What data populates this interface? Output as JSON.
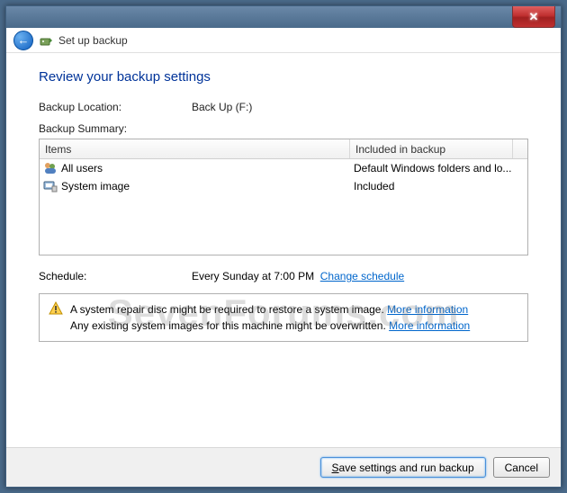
{
  "window": {
    "close": "✕"
  },
  "header": {
    "title": "Set up backup"
  },
  "page": {
    "title": "Review your backup settings",
    "backup_location_label": "Backup Location:",
    "backup_location_value": "Back Up (F:)",
    "summary_label": "Backup Summary:"
  },
  "table": {
    "col1": "Items",
    "col2": "Included in backup",
    "rows": [
      {
        "icon": "users",
        "item": "All users",
        "included": "Default Windows folders and lo..."
      },
      {
        "icon": "system",
        "item": "System image",
        "included": "Included"
      }
    ]
  },
  "schedule": {
    "label": "Schedule:",
    "value": "Every Sunday at 7:00 PM",
    "change_link": "Change schedule"
  },
  "notice": {
    "line1": "A system repair disc might be required to restore a system image.",
    "link1": "More information",
    "line2": "Any existing system images for this machine might be overwritten.",
    "link2": "More information"
  },
  "footer": {
    "primary_prefix": "S",
    "primary_rest": "ave settings and run backup",
    "cancel": "Cancel"
  },
  "watermark": "SevenForums.com"
}
